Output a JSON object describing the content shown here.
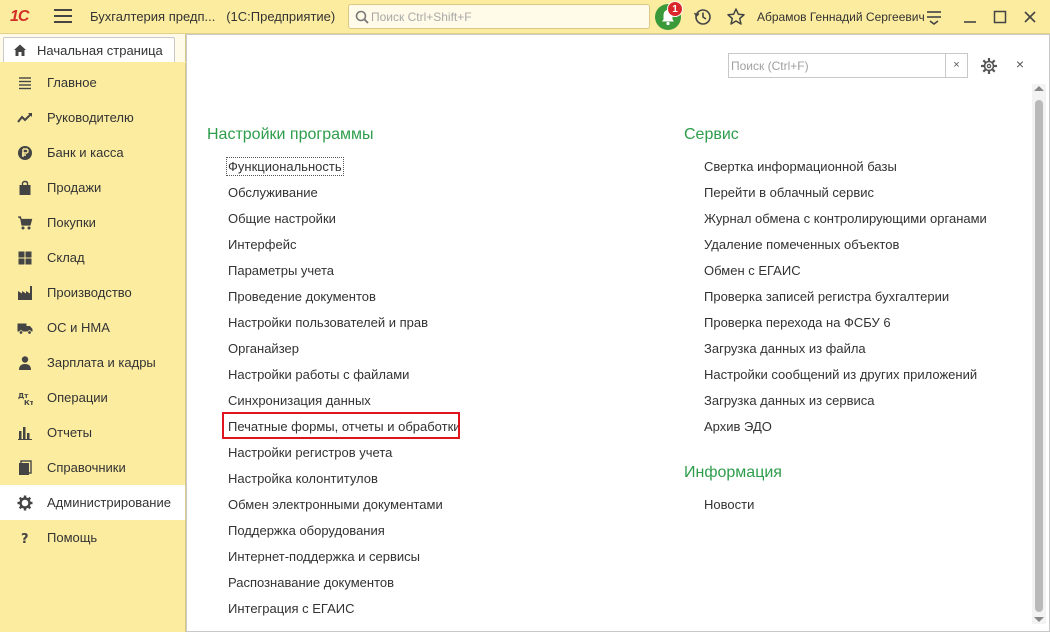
{
  "topbar": {
    "logo": "1С",
    "app_title": "Бухгалтерия предп...",
    "app_platform": "(1С:Предприятие)",
    "search_placeholder": "Поиск Ctrl+Shift+F",
    "notifications_count": "1",
    "user_name": "Абрамов Геннадий Сергеевич"
  },
  "home_tab": {
    "label": "Начальная страница"
  },
  "sidebar": {
    "items": [
      {
        "label": "Главное",
        "icon": "menu-lines-icon"
      },
      {
        "label": "Руководителю",
        "icon": "trend-up-icon"
      },
      {
        "label": "Банк и касса",
        "icon": "ruble-coin-icon"
      },
      {
        "label": "Продажи",
        "icon": "shopping-bag-icon"
      },
      {
        "label": "Покупки",
        "icon": "cart-icon"
      },
      {
        "label": "Склад",
        "icon": "warehouse-icon"
      },
      {
        "label": "Производство",
        "icon": "factory-icon"
      },
      {
        "label": "ОС и НМА",
        "icon": "truck-icon"
      },
      {
        "label": "Зарплата и кадры",
        "icon": "person-icon"
      },
      {
        "label": "Операции",
        "icon": "debit-credit-icon"
      },
      {
        "label": "Отчеты",
        "icon": "bar-chart-icon"
      },
      {
        "label": "Справочники",
        "icon": "books-icon"
      },
      {
        "label": "Администрирование",
        "icon": "gear-icon"
      },
      {
        "label": "Помощь",
        "icon": "question-icon"
      }
    ],
    "active_index": 12
  },
  "main": {
    "search_placeholder": "Поиск (Ctrl+F)",
    "search_clear": "×",
    "close_symbol": "×",
    "left_section": {
      "title": "Настройки программы",
      "links": [
        "Функциональность",
        "Обслуживание",
        "Общие настройки",
        "Интерфейс",
        "Параметры учета",
        "Проведение документов",
        "Настройки пользователей и прав",
        "Органайзер",
        "Настройки работы с файлами",
        "Синхронизация данных",
        "Печатные формы, отчеты и обработки",
        "Настройки регистров учета",
        "Настройка колонтитулов",
        "Обмен электронными документами",
        "Поддержка оборудования",
        "Интернет-поддержка и сервисы",
        "Распознавание документов",
        "Интеграция с ЕГАИС"
      ]
    },
    "service_section": {
      "title": "Сервис",
      "links": [
        "Свертка информационной базы",
        "Перейти в облачный сервис",
        "Журнал обмена с контролирующими органами",
        "Удаление помеченных объектов",
        "Обмен с ЕГАИС",
        "Проверка записей регистра бухгалтерии",
        "Проверка перехода на ФСБУ 6",
        "Загрузка данных из файла",
        "Настройки сообщений из других приложений",
        "Загрузка данных из сервиса",
        "Архив ЭДО"
      ]
    },
    "info_section": {
      "title": "Информация",
      "links": [
        "Новости"
      ]
    }
  },
  "colors": {
    "sidebar_bg": "#fbeca0",
    "section_title": "#2e9d4b",
    "highlight_box": "#e0141e",
    "logo": "#d32e26"
  }
}
